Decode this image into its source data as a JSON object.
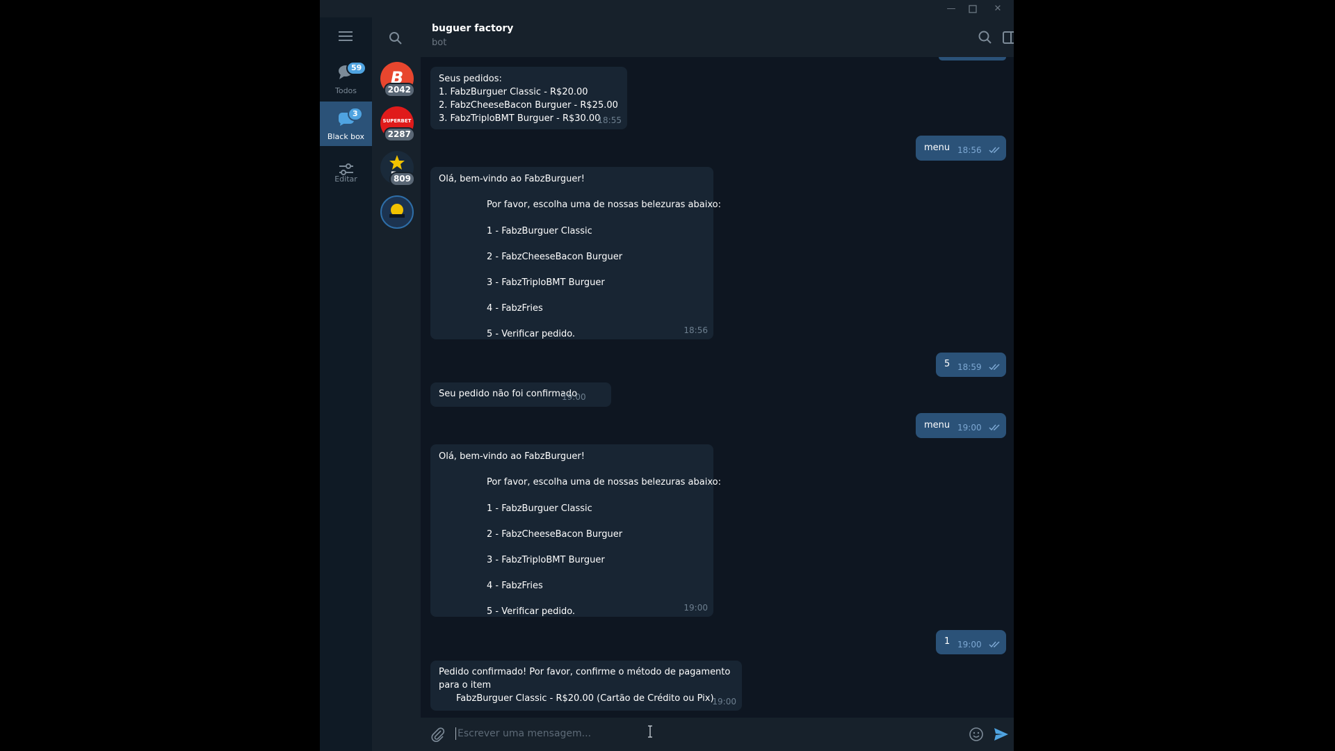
{
  "folders": [
    {
      "label": "Todos",
      "badge": "59",
      "icon": "chats-icon"
    },
    {
      "label": "Black box",
      "badge": "3",
      "icon": "folder-chats-icon"
    },
    {
      "label": "Editar",
      "icon": "sliders-icon"
    }
  ],
  "chats": [
    {
      "badge": "2042",
      "color": "#e8462e",
      "icon": "b-logo-icon"
    },
    {
      "badge": "2287",
      "color": "#e01b1b",
      "icon": "superbet-logo-icon"
    },
    {
      "badge": "809",
      "color": "#1a2a3a",
      "icon": "star-b-logo-icon"
    },
    {
      "color": "#1c3350",
      "icon": "blackbox-logo-icon"
    }
  ],
  "header": {
    "title": "buguer factory",
    "subtitle": "bot"
  },
  "messages": {
    "m1": {
      "lines": [
        "Seus pedidos:",
        "1. FabzBurguer Classic - R$20.00",
        "2. FabzCheeseBacon Burguer - R$25.00",
        "3. FabzTriploBMT Burguer - R$30.00"
      ],
      "time": "18:55"
    },
    "m2": {
      "text": "menu",
      "time": "18:56"
    },
    "m3": {
      "lines": [
        "Olá, bem-vindo ao FabzBurguer!",
        "Por favor, escolha uma de nossas belezuras abaixo:",
        "1 - FabzBurguer Classic",
        "2 - FabzCheeseBacon Burguer",
        "3 - FabzTriploBMT Burguer",
        "4 - FabzFries",
        "5 - Verificar pedido."
      ],
      "time": "18:56"
    },
    "m4": {
      "text": "5",
      "time": "18:59"
    },
    "m5": {
      "text": "Seu pedido não foi confirmado",
      "time": "19:00"
    },
    "m6": {
      "text": "menu",
      "time": "19:00"
    },
    "m7": {
      "lines": [
        "Olá, bem-vindo ao FabzBurguer!",
        "Por favor, escolha uma de nossas belezuras abaixo:",
        "1 - FabzBurguer Classic",
        "2 - FabzCheeseBacon Burguer",
        "3 - FabzTriploBMT Burguer",
        "4 - FabzFries",
        "5 - Verificar pedido."
      ],
      "time": "19:00"
    },
    "m8": {
      "text": "1",
      "time": "19:00"
    },
    "m9": {
      "lines": [
        "Pedido confirmado! Por favor, confirme o método de pagamento",
        "para o item",
        "FabzBurguer Classic - R$20.00 (Cartão de Crédito ou Pix)"
      ],
      "time": "19:00"
    }
  },
  "composer": {
    "placeholder": "Escrever uma mensagem..."
  },
  "colors": {
    "window_bg": "#0e1621",
    "panel_bg": "#17212b",
    "incoming": "#182533",
    "outgoing": "#2b5278",
    "accent": "#4fa3e0"
  }
}
